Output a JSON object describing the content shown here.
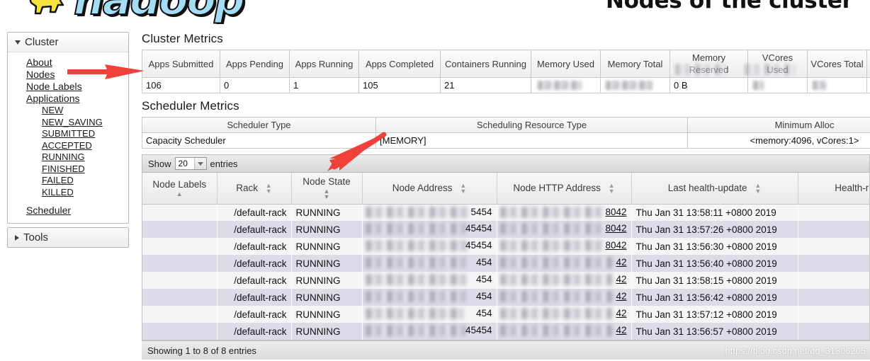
{
  "banner": {
    "logo_text": "hadoop",
    "logo_icon": "hadoop-elephant-logo",
    "page_title": "Nodes of the cluster"
  },
  "sidebar": {
    "cluster_group": {
      "label": "Cluster",
      "items": [
        {
          "label": "About"
        },
        {
          "label": "Nodes"
        },
        {
          "label": "Node Labels"
        },
        {
          "label": "Applications"
        }
      ],
      "application_states": [
        {
          "label": "NEW"
        },
        {
          "label": "NEW_SAVING"
        },
        {
          "label": "SUBMITTED"
        },
        {
          "label": "ACCEPTED"
        },
        {
          "label": "RUNNING"
        },
        {
          "label": "FINISHED"
        },
        {
          "label": "FAILED"
        },
        {
          "label": "KILLED"
        }
      ],
      "scheduler": {
        "label": "Scheduler"
      }
    },
    "tools_group": {
      "label": "Tools"
    }
  },
  "cluster_metrics": {
    "title": "Cluster Metrics",
    "columns": [
      "Apps Submitted",
      "Apps Pending",
      "Apps Running",
      "Apps Completed",
      "Containers Running",
      "Memory Used",
      "Memory Total",
      "Memory Reserved",
      "VCores Used",
      "VCores Total"
    ],
    "values": {
      "apps_submitted": "106",
      "apps_pending": "0",
      "apps_running": "1",
      "apps_completed": "105",
      "containers_running": "21",
      "memory_used": "",
      "memory_total": "",
      "memory_reserved": "0 B",
      "vcores_used": "",
      "vcores_total": ""
    }
  },
  "scheduler_metrics": {
    "title": "Scheduler Metrics",
    "columns": [
      "Scheduler Type",
      "Scheduling Resource Type",
      "Minimum Alloc"
    ],
    "row": {
      "scheduler_type": "Capacity Scheduler",
      "scheduling_resource_type": "[MEMORY]",
      "minimum_alloc": "<memory:4096, vCores:1>"
    }
  },
  "nodes_table": {
    "show_prefix": "Show",
    "show_value": "20",
    "show_suffix": "entries",
    "columns": [
      "Node Labels",
      "Rack",
      "Node State",
      "Node Address",
      "Node HTTP Address",
      "Last health-update",
      "Health-repo"
    ],
    "rows": [
      {
        "node_labels": "",
        "rack": "/default-rack",
        "node_state": "RUNNING",
        "address_port": "5454",
        "http_port": "8042",
        "last_health_update": "Thu Jan 31 13:58:11 +0800 2019"
      },
      {
        "node_labels": "",
        "rack": "/default-rack",
        "node_state": "RUNNING",
        "address_port": "45454",
        "http_port": "8042",
        "last_health_update": "Thu Jan 31 13:57:26 +0800 2019"
      },
      {
        "node_labels": "",
        "rack": "/default-rack",
        "node_state": "RUNNING",
        "address_port": "45454",
        "http_port": "8042",
        "last_health_update": "Thu Jan 31 13:56:30 +0800 2019"
      },
      {
        "node_labels": "",
        "rack": "/default-rack",
        "node_state": "RUNNING",
        "address_port": "454",
        "http_port": "42",
        "last_health_update": "Thu Jan 31 13:56:40 +0800 2019"
      },
      {
        "node_labels": "",
        "rack": "/default-rack",
        "node_state": "RUNNING",
        "address_port": "454",
        "http_port": "42",
        "last_health_update": "Thu Jan 31 13:58:15 +0800 2019"
      },
      {
        "node_labels": "",
        "rack": "/default-rack",
        "node_state": "RUNNING",
        "address_port": "454",
        "http_port": "42",
        "last_health_update": "Thu Jan 31 13:56:42 +0800 2019"
      },
      {
        "node_labels": "",
        "rack": "/default-rack",
        "node_state": "RUNNING",
        "address_port": "454",
        "http_port": "42",
        "last_health_update": "Thu Jan 31 13:57:12 +0800 2019"
      },
      {
        "node_labels": "",
        "rack": "/default-rack",
        "node_state": "RUNNING",
        "address_port": "45454",
        "http_port": "42",
        "last_health_update": "Thu Jan 31 13:56:57 +0800 2019"
      }
    ],
    "footer_info": "Showing 1 to 8 of 8 entries"
  },
  "annotations": {
    "arrow_color": "#f0403a",
    "arrow_nodes": "arrow-pointing-to-nodes-link",
    "arrow_show_entries": "arrow-pointing-to-show-entries-bar"
  },
  "watermark": {
    "text": "https://blog.csdn.net/qq_31806205"
  }
}
